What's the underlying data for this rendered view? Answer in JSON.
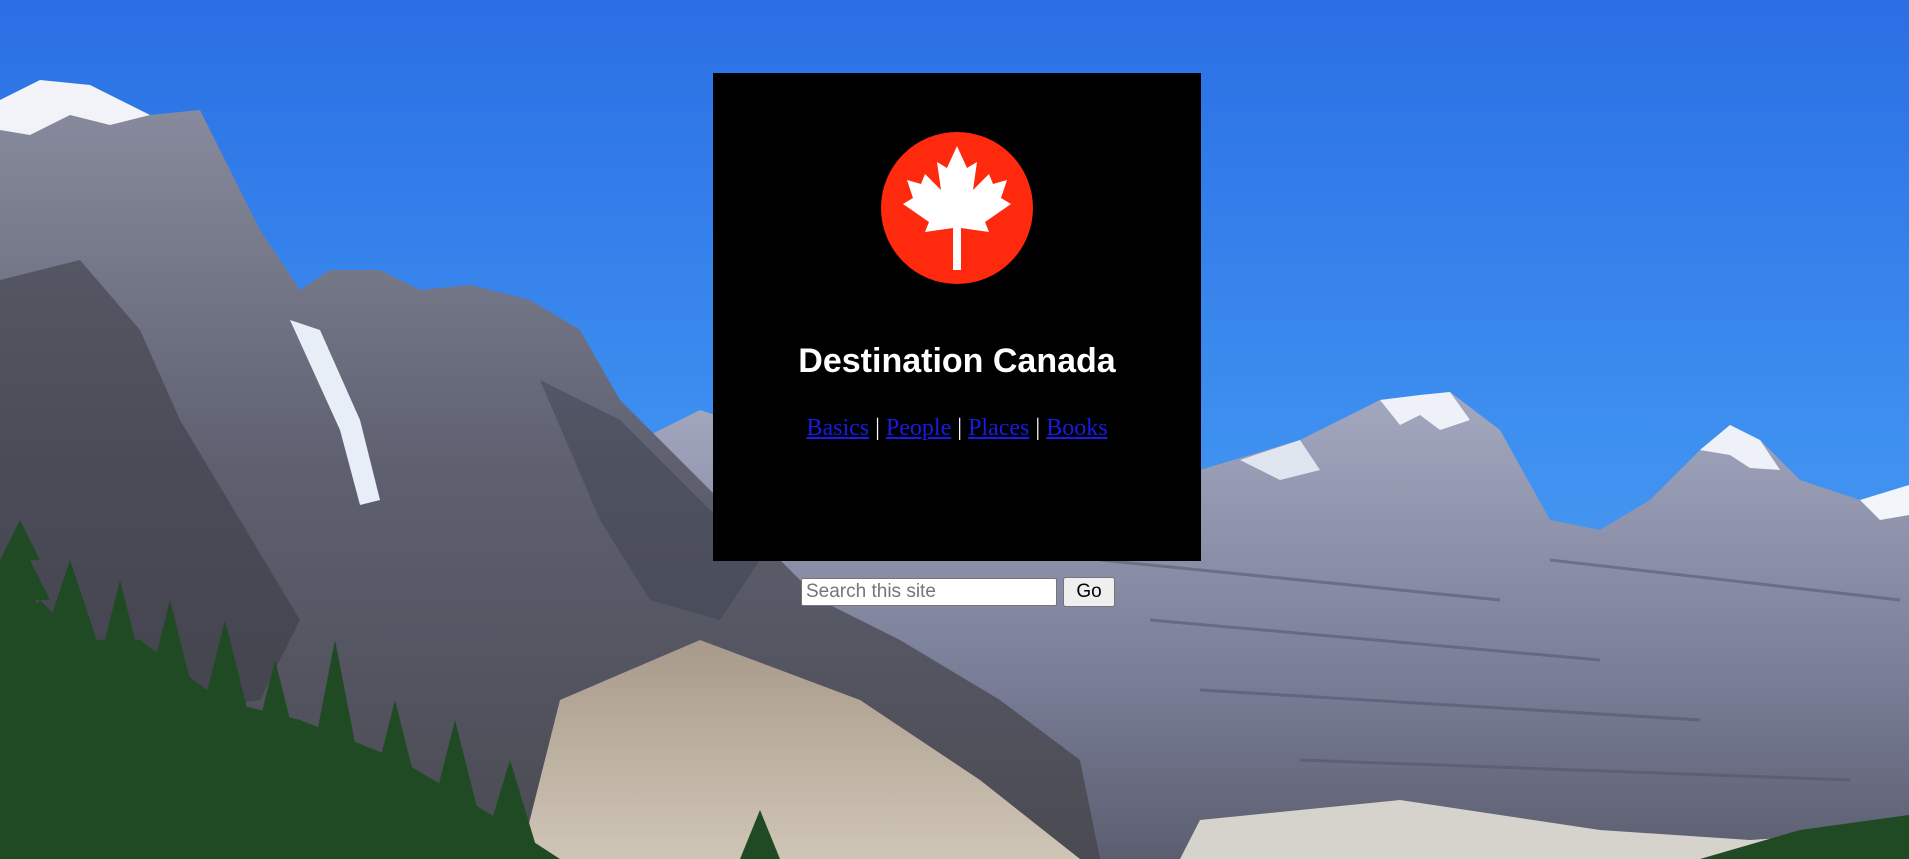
{
  "site": {
    "title": "Destination Canada"
  },
  "logo": {
    "icon": "maple-leaf-icon",
    "circle_color": "#ff2a0e",
    "leaf_color": "#ffffff"
  },
  "nav": {
    "items": [
      {
        "label": "Basics"
      },
      {
        "label": "People"
      },
      {
        "label": "Places"
      },
      {
        "label": "Books"
      }
    ],
    "separator": "|"
  },
  "search": {
    "placeholder": "Search this site",
    "value": "",
    "button_label": "Go"
  },
  "colors": {
    "panel": "#000000",
    "link": "#1a1ae6",
    "sky": "#2f78e6"
  }
}
